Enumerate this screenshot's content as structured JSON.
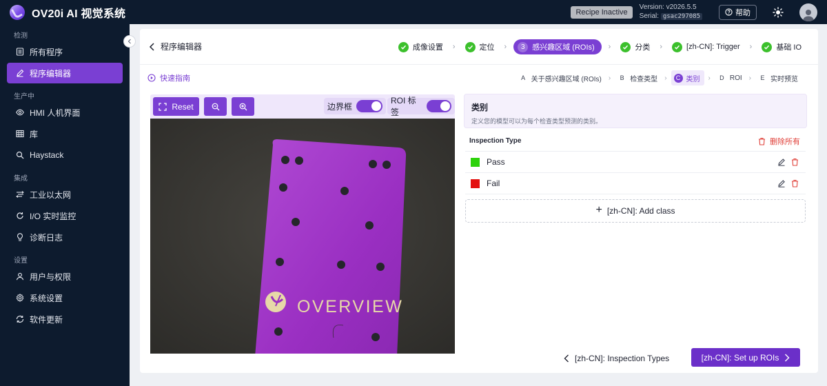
{
  "app": {
    "title": "OV20i AI 视觉系统",
    "recipe_status": "Recipe Inactive",
    "version": "Version: v2026.5.5",
    "serial_label": "Serial:",
    "serial_value": "gsac297085",
    "help_label": "帮助"
  },
  "sidebar": {
    "sections": [
      {
        "label": "检测",
        "items": [
          {
            "label": "所有程序",
            "icon": "list-icon"
          },
          {
            "label": "程序编辑器",
            "icon": "edit-icon",
            "active": true
          }
        ]
      },
      {
        "label": "生产中",
        "items": [
          {
            "label": "HMI 人机界面",
            "icon": "eye-icon"
          },
          {
            "label": "库",
            "icon": "grid-icon"
          },
          {
            "label": "Haystack",
            "icon": "search-icon"
          }
        ]
      },
      {
        "label": "集成",
        "items": [
          {
            "label": "工业以太网",
            "icon": "network-icon"
          },
          {
            "label": "I/O 实时监控",
            "icon": "io-icon"
          },
          {
            "label": "诊断日志",
            "icon": "bulb-icon"
          }
        ]
      },
      {
        "label": "设置",
        "items": [
          {
            "label": "用户与权限",
            "icon": "user-icon"
          },
          {
            "label": "系统设置",
            "icon": "gear-icon"
          },
          {
            "label": "软件更新",
            "icon": "refresh-icon"
          }
        ]
      }
    ]
  },
  "header": {
    "back_label": "程序编辑器",
    "steps": [
      {
        "label": "成像设置",
        "state": "done"
      },
      {
        "label": "定位",
        "state": "done"
      },
      {
        "num": "3",
        "label": "感兴趣区域 (ROIs)",
        "state": "current"
      },
      {
        "label": "分类",
        "state": "done"
      },
      {
        "label": "[zh-CN]: Trigger",
        "state": "done"
      },
      {
        "label": "基础 IO",
        "state": "done"
      }
    ]
  },
  "subheader": {
    "quick_guide": "快速指南",
    "substeps": [
      {
        "letter": "A",
        "label": "关于感兴趣区域 (ROIs)"
      },
      {
        "letter": "B",
        "label": "检查类型"
      },
      {
        "letter": "C",
        "label": "类别",
        "current": true
      },
      {
        "letter": "D",
        "label": "ROI"
      },
      {
        "letter": "E",
        "label": "实时预览"
      }
    ]
  },
  "toolbar": {
    "reset_label": "Reset",
    "bbox_label": "边界框",
    "bbox_on": true,
    "roi_label": "ROI 标签",
    "roi_on": true
  },
  "photo": {
    "brand_text": "OVERVIEW"
  },
  "classes": {
    "title": "类别",
    "description": "定义您的模型可以为每个检查类型预测的类别。",
    "column_header": "Inspection Type",
    "delete_all_label": "删除所有",
    "rows": [
      {
        "name": "Pass",
        "color": "#2ed20c"
      },
      {
        "name": "Fail",
        "color": "#e3100f"
      }
    ],
    "add_label": "[zh-CN]: Add class"
  },
  "footer": {
    "prev_label": "[zh-CN]: Inspection Types",
    "next_label": "[zh-CN]: Set up ROIs"
  },
  "colors": {
    "accent": "#7a3fd3",
    "sidebar_bg": "#0d1b2e",
    "check_green": "#3cc02c",
    "danger": "#e0413a"
  }
}
